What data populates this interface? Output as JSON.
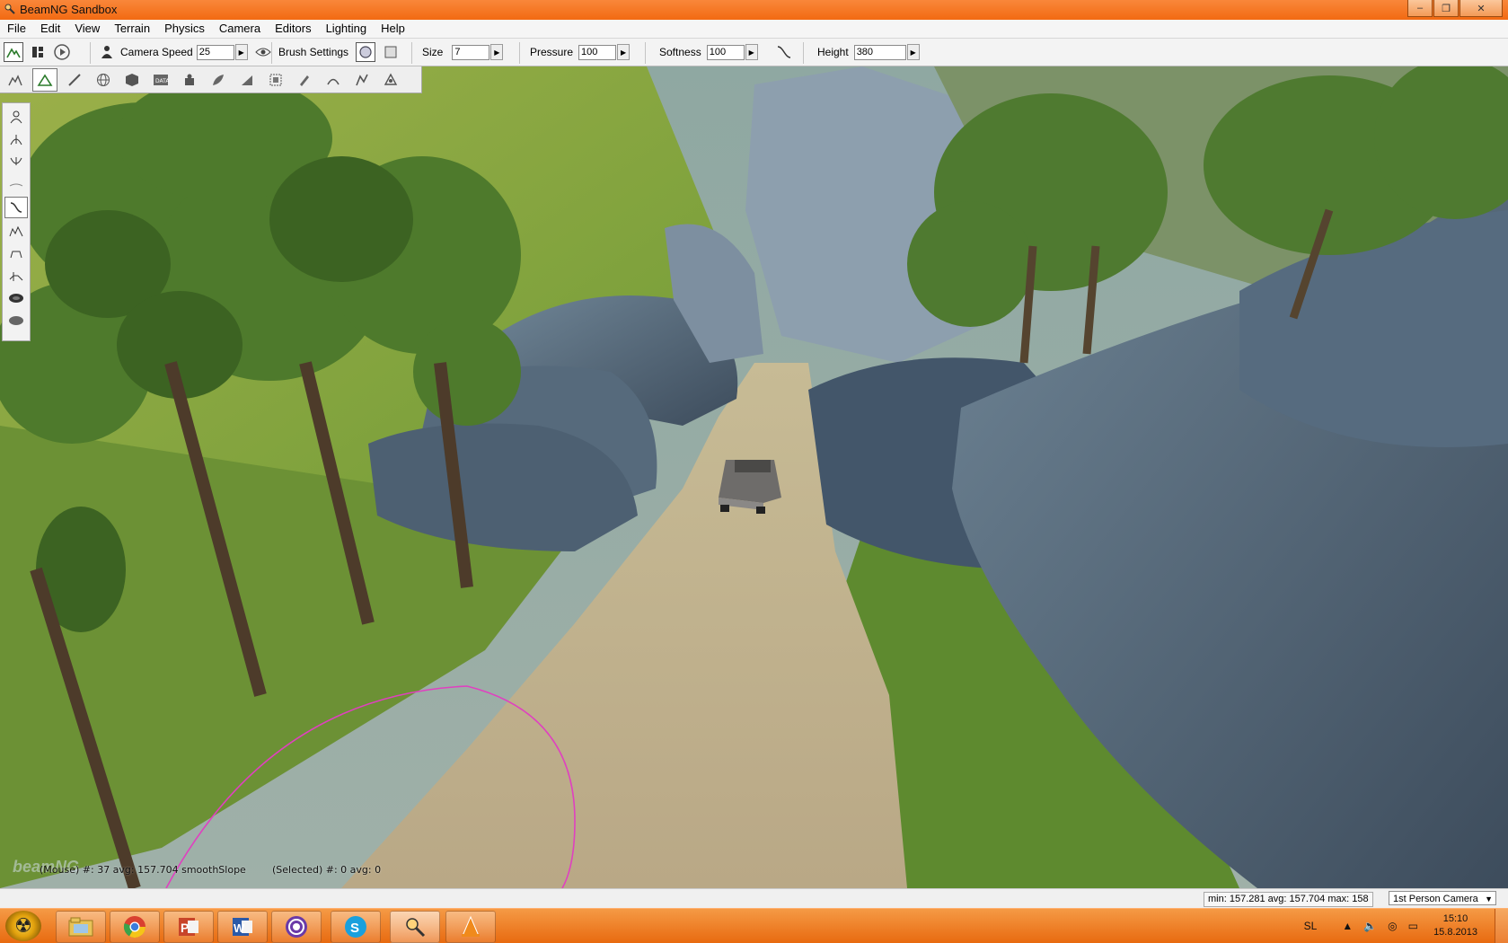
{
  "window": {
    "title": "BeamNG Sandbox"
  },
  "window_buttons": {
    "minimize": "‒",
    "maximize": "❐",
    "close": "✕"
  },
  "menu": [
    "File",
    "Edit",
    "View",
    "Terrain",
    "Physics",
    "Camera",
    "Editors",
    "Lighting",
    "Help"
  ],
  "toolbar": {
    "camera_speed_label": "Camera Speed",
    "camera_speed_value": "25",
    "brush_settings_label": "Brush Settings",
    "size_label": "Size",
    "size_value": "7",
    "pressure_label": "Pressure",
    "pressure_value": "100",
    "softness_label": "Softness",
    "softness_value": "100",
    "height_label": "Height",
    "height_value": "380"
  },
  "viewport": {
    "mouse_info": "(Mouse) #: 37  avg: 157.704 smoothSlope",
    "selected_info": "(Selected) #: 0  avg: 0",
    "watermark": "beamNG"
  },
  "statusbar": {
    "stats": "min: 157.281  avg: 157.704  max: 158",
    "camera_mode": "1st Person Camera"
  },
  "taskbar": {
    "apps": [
      "Windows Explorer",
      "Google Chrome",
      "PowerPoint",
      "Word",
      "Tor",
      "Skype",
      "BeamNG",
      "VLC"
    ],
    "language": "SL",
    "time": "15:10",
    "date": "15.8.2013"
  },
  "colors": {
    "title_bar": "#f27a22",
    "taskbar": "#ee7d24",
    "brush_circle": "#e040c0"
  }
}
